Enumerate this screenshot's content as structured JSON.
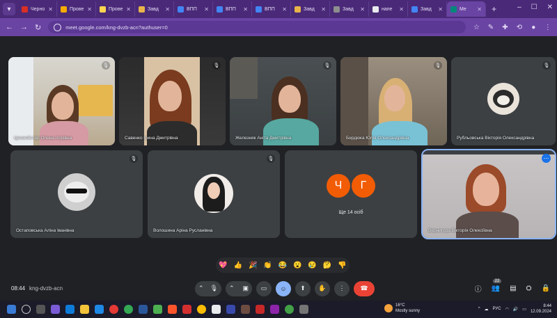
{
  "browser": {
    "tabs": [
      {
        "label": "Черно",
        "color": "#d93025"
      },
      {
        "label": "Прове",
        "color": "#f9ab00"
      },
      {
        "label": "Прове",
        "color": "#ffd54f"
      },
      {
        "label": "Завд",
        "color": "#e8b44a"
      },
      {
        "label": "ВПП",
        "color": "#4285f4"
      },
      {
        "label": "ВПП",
        "color": "#4285f4"
      },
      {
        "label": "ВПП",
        "color": "#4285f4"
      },
      {
        "label": "Завд",
        "color": "#e8b44a"
      },
      {
        "label": "Завд",
        "color": "#8e8e8e"
      },
      {
        "label": "напе",
        "color": "#e8eaed"
      },
      {
        "label": "Завд",
        "color": "#4285f4"
      },
      {
        "label": "Me",
        "color": "#00897b"
      }
    ],
    "url": "meet.google.com/kng-dvzb-acn?authuser=0"
  },
  "participants": [
    {
      "name": "Цехмейстер Олена Ігорівна"
    },
    {
      "name": "Савенко Ірина Дмитрівна"
    },
    {
      "name": "Железняк Аніта Дмитрівна"
    },
    {
      "name": "Бердюка Юлія Олександрівна"
    },
    {
      "name": "Рубльовська Вікторія Олександрівна"
    },
    {
      "name": "Остаповська Аліна Іванівна"
    },
    {
      "name": "Волошина Аріна Русланівна"
    },
    {
      "name": "Вернигора Вікторія Олексіївна"
    }
  ],
  "others_tile": {
    "initials": [
      "Ч",
      "Г"
    ],
    "colors": [
      "#f25c05",
      "#f25c05"
    ],
    "label": "Ще 14 осіб"
  },
  "reactions": [
    "💖",
    "👍",
    "🎉",
    "👏",
    "😂",
    "😮",
    "😢",
    "🤔",
    "👎"
  ],
  "meeting": {
    "time": "08:44",
    "code": "kng-dvzb-acn",
    "people_count": "22"
  },
  "system": {
    "weather_temp": "16°C",
    "weather_desc": "Mostly sunny",
    "lang": "РУС",
    "clock": "8:44",
    "date": "12.09.2024"
  }
}
